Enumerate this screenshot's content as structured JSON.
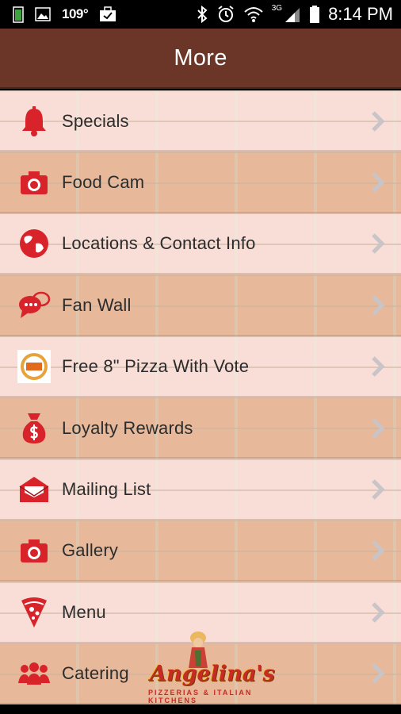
{
  "status_bar": {
    "temperature": "109°",
    "network": "3G",
    "time": "8:14 PM",
    "icons": [
      "battery-small-icon",
      "image-icon",
      "briefcase-check-icon",
      "bluetooth-icon",
      "alarm-icon",
      "wifi-icon",
      "signal-icon",
      "battery-icon"
    ]
  },
  "header": {
    "title": "More"
  },
  "colors": {
    "header": "#6b3628",
    "icon_red": "#d8232a",
    "chevron": "#c9c4c8"
  },
  "menu": {
    "items": [
      {
        "label": "Specials",
        "icon": "bell-icon"
      },
      {
        "label": "Food Cam",
        "icon": "camera-icon"
      },
      {
        "label": "Locations & Contact Info",
        "icon": "globe-icon"
      },
      {
        "label": "Fan Wall",
        "icon": "chat-bubbles-icon"
      },
      {
        "label": "Free 8\" Pizza With Vote",
        "icon": "best-of-badge-icon"
      },
      {
        "label": "Loyalty Rewards",
        "icon": "money-bag-icon"
      },
      {
        "label": "Mailing List",
        "icon": "envelope-icon"
      },
      {
        "label": "Gallery",
        "icon": "camera-icon"
      },
      {
        "label": "Menu",
        "icon": "pizza-slice-icon"
      },
      {
        "label": "Catering",
        "icon": "people-icon"
      }
    ]
  },
  "watermark": {
    "brand": "Angelina's",
    "tagline": "PIZZERIAS & ITALIAN KITCHENS"
  }
}
